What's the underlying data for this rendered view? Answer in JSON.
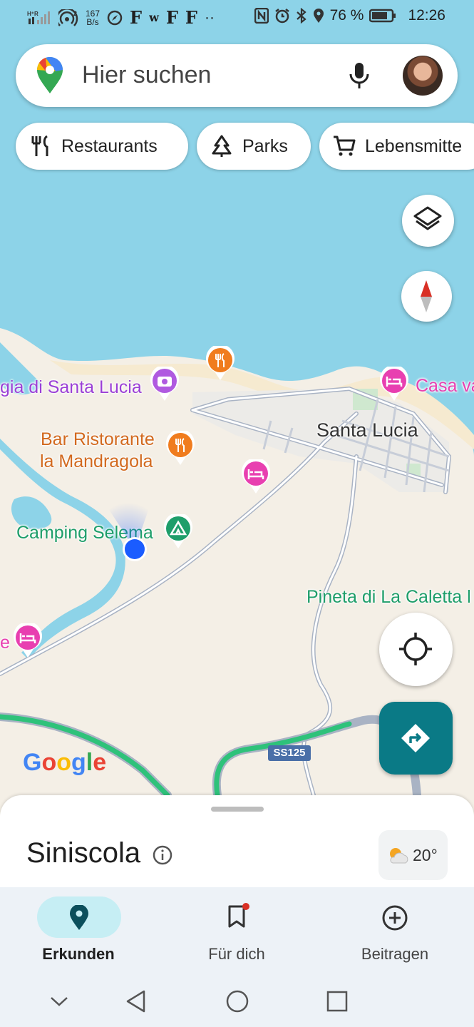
{
  "status_bar": {
    "network_speed_value": "167",
    "network_speed_unit": "B/s",
    "notif_letters": [
      "F",
      "w",
      "F",
      "F"
    ],
    "more_dots": "··",
    "battery_percent": "76 %",
    "time": "12:26"
  },
  "search": {
    "placeholder": "Hier suchen"
  },
  "chips": [
    {
      "label": "Restaurants",
      "icon": "fork-knife-icon"
    },
    {
      "label": "Parks",
      "icon": "tree-icon"
    },
    {
      "label": "Lebensmitte",
      "icon": "shopping-cart-icon"
    }
  ],
  "map": {
    "labels": {
      "spiaggia": "gia di Santa Lucia",
      "casa": "Casa va",
      "santa_lucia": "Santa Lucia",
      "bar_line1": "Bar Ristorante",
      "bar_line2": "la Mandragola",
      "camping": "Camping Selema",
      "pineta": "Pineta di La Caletta l",
      "edge_e": "e",
      "road_badge": "SS125",
      "google": "Google"
    },
    "colors": {
      "water": "#8dd3e8",
      "land": "#f4efe6",
      "poi_restaurant": "#f07c1e",
      "poi_hotel": "#e83fb0",
      "poi_camera": "#b05ae0",
      "poi_camping": "#1e9e6a",
      "route": "#2ec27a",
      "location": "#1a5cff"
    }
  },
  "bottom_sheet": {
    "title": "Siniscola",
    "weather_temp": "20°"
  },
  "bottom_nav": [
    {
      "label": "Erkunden",
      "icon": "location-pin-icon",
      "active": true
    },
    {
      "label": "Für dich",
      "icon": "bookmark-icon",
      "active": false
    },
    {
      "label": "Beitragen",
      "icon": "add-circle-icon",
      "active": false
    }
  ],
  "accent": "#0a7a86"
}
